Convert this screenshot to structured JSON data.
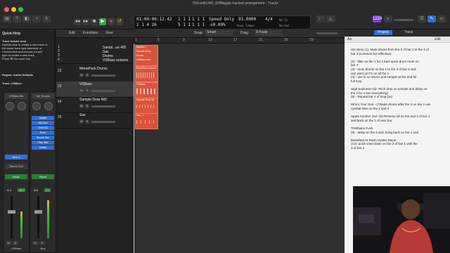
{
  "window": {
    "title": "016-edit1442_DJMaggie tracked arrangement - Tracks"
  },
  "toolbar": {
    "buttons": [
      "◂◂",
      "▸▸",
      "■",
      "▶",
      "●",
      "↺"
    ]
  },
  "lcd": {
    "time": "01:00:00:12.42",
    "bars": "1  1  4  26",
    "pos1": "1  1  1",
    "pos2": "5  1  1",
    "pos3": "1  1  1",
    "pos4": "1  1  1",
    "mode": "Speed Only",
    "mode_value": "±0.00%",
    "tempo": "93.0000",
    "tempo_label": "Keep Tempo",
    "signature": "4/4",
    "key": "No In",
    "out": "No Out"
  },
  "quickhelp": {
    "title": "Quick Help",
    "lines": [
      "Track header area",
      "Double-click to create a new track of",
      "the same track type selected, or",
      "Control-click and choose a track",
      "type to create a new track.",
      "Press ⌘/ for more info."
    ],
    "region_label": "Region: Audio Defaults",
    "track_label": "Track: VSBass"
  },
  "strips": [
    {
      "name": "VSBass tbs",
      "plugins": [],
      "send": "Bus 4",
      "stereo": "Stereo Out",
      "read": "Read",
      "vol": "-5.4",
      "peak": "-11.7",
      "footer": "VSBass"
    },
    {
      "name": "Ultr Scrwls",
      "plugins": [
        "Multpr",
        "AM.Jmb",
        "Tube EQ",
        "Echo",
        "Reverb Hex",
        "Filter Wth",
        "Limiter"
      ],
      "send": "",
      "stereo": "",
      "read": "Read",
      "vol": "-5.6",
      "peak": "-1.7",
      "footer": "Bus"
    }
  ],
  "tracks_toolbar": {
    "edit": "Edit",
    "functions": "Functions",
    "view": "View",
    "snap_label": "Snap:",
    "snap_value": "Smart",
    "drag_label": "Drag:",
    "drag_value": "X-Fade"
  },
  "ruler": {
    "bars": [
      "1",
      "5",
      "9",
      "13",
      "17",
      "21",
      "25",
      "29"
    ]
  },
  "tracks": [
    {
      "num": "1",
      "name": "Sampl...ue 482"
    },
    {
      "num": "2",
      "name": "Sax"
    },
    {
      "num": "3",
      "name": "Drums"
    },
    {
      "num": "4",
      "name": "VSBass octaves"
    },
    {
      "num": "22",
      "name": "MonoPack Drums"
    },
    {
      "num": "23",
      "name": "VSBass"
    },
    {
      "num": "24",
      "name": "Sample Drop 482"
    },
    {
      "num": "25",
      "name": "Sax"
    }
  ],
  "regions": [
    {
      "name": "Marker 1"
    },
    {
      "name": "Sample Drop"
    },
    {
      "name": "Drums"
    },
    {
      "name": "VSBass octa"
    },
    {
      "name": "MonoPack Drums"
    },
    {
      "name": "VSBass"
    },
    {
      "name": "Sample Drop 48"
    },
    {
      "name": "Sax_1"
    }
  ],
  "notes_tabs": {
    "project": "Project",
    "track": "Track",
    "edit": "Edit"
  },
  "notes": [
    "His Story  (1)- Mute drums from the 3 of bar 3 to the 4 of",
    "bar  4 (common but effective)",
    "",
    "(2)      - filter on the 1 for 3 bars quick drum mute on",
    "bar 4",
    "(3)      - mute drums on bar 1 to the 3 of bar 4 and",
    "use wind up FX on all the 1",
    "(4)      - use fx on drums and sample at the end for",
    "full loop",
    "",
    "High Explosive (5)- Pitch drop on sample and delay on",
    "the 2 for 1 bar  (everything)",
    "(6)      - Repeat bar 4 of loop (3x)",
    "",
    "Who's Your God - (7)Mute drums after the 2 on bar 4 use",
    "cymbal riser on the 2 and 4",
    "",
    "Spark Another Owl -(8) Reverse all on the and 3 of bar 4",
    "and back on the 1 of next bar",
    "",
    "Trebbiano Funk",
    "(9)      - delay on the 3 and, bring back on the 4 and",
    "",
    "Breakfast At Swan Oyster Depot",
    "(10)- quick wind down on the 3 of bar 1 until the",
    "3 of bar 2"
  ],
  "colors": {
    "region": "#d9533c",
    "accent_green": "#2fa84f",
    "accent_blue": "#2f6fd6",
    "notes_bg": "#f4f4f4"
  }
}
